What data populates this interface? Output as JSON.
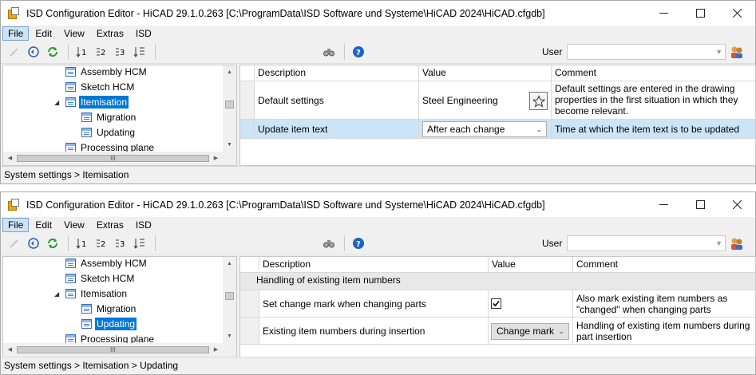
{
  "windows": [
    {
      "title": "ISD Configuration Editor  - HiCAD 29.1.0.263 [C:\\ProgramData\\ISD Software und Systeme\\HiCAD 2024\\HiCAD.cfgdb]",
      "menu": [
        "File",
        "Edit",
        "View",
        "Extras",
        "ISD"
      ],
      "active_menu": "File",
      "toolbar": {
        "user_label": "User",
        "user_value": ""
      },
      "tree": [
        {
          "label": "Assembly HCM",
          "level": 1,
          "selected": false
        },
        {
          "label": "Sketch HCM",
          "level": 1,
          "selected": false
        },
        {
          "label": "Itemisation",
          "level": 1,
          "selected": true,
          "expanded": true
        },
        {
          "label": "Migration",
          "level": 2,
          "selected": false
        },
        {
          "label": "Updating",
          "level": 2,
          "selected": false
        },
        {
          "label": "Processing plane",
          "level": 1,
          "selected": false
        }
      ],
      "grid": {
        "headers": {
          "description": "Description",
          "value": "Value",
          "comment": "Comment"
        },
        "rows": [
          {
            "description": "Default settings",
            "value": "Steel Engineering",
            "comment": "Default settings are entered in the drawing properties in the first situation in which they become relevant."
          },
          {
            "description": "Update item text",
            "value": "After each change",
            "comment": "Time at which the item text is to be updated"
          }
        ]
      },
      "status": "System settings > Itemisation"
    },
    {
      "title": "ISD Configuration Editor  - HiCAD 29.1.0.263 [C:\\ProgramData\\ISD Software und Systeme\\HiCAD 2024\\HiCAD.cfgdb]",
      "menu": [
        "File",
        "Edit",
        "View",
        "Extras",
        "ISD"
      ],
      "active_menu": "File",
      "toolbar": {
        "user_label": "User",
        "user_value": ""
      },
      "tree": [
        {
          "label": "Assembly HCM",
          "level": 1,
          "selected": false
        },
        {
          "label": "Sketch HCM",
          "level": 1,
          "selected": false
        },
        {
          "label": "Itemisation",
          "level": 1,
          "selected": false,
          "expanded": true
        },
        {
          "label": "Migration",
          "level": 2,
          "selected": false
        },
        {
          "label": "Updating",
          "level": 2,
          "selected": true
        },
        {
          "label": "Processing plane",
          "level": 1,
          "selected": false
        }
      ],
      "grid": {
        "headers": {
          "description": "Description",
          "value": "Value",
          "comment": "Comment"
        },
        "group": "Handling of existing item numbers",
        "rows": [
          {
            "description": "Set change mark when changing parts",
            "value": "checked",
            "comment": "Also mark existing item numbers as \"changed\" when changing parts"
          },
          {
            "description": "Existing item numbers during insertion",
            "value": "Change mark",
            "comment": "Handling of existing item numbers during part insertion"
          }
        ]
      },
      "status": "System settings > Itemisation > Updating"
    }
  ],
  "icons": {
    "edit": "pencil-icon",
    "back": "undo-icon",
    "refresh": "refresh-icon",
    "sort1": "sort-level1-icon",
    "sort2": "sort-level2-icon",
    "sort3": "sort-level3-icon",
    "sort4": "sort-all-icon",
    "find": "binoculars-icon",
    "help": "help-icon",
    "users": "users-icon",
    "star": "star-icon"
  },
  "scroll_glyph": "III",
  "toolbar_labels": {
    "sort1": "1",
    "sort2": "2",
    "sort3": "3"
  }
}
